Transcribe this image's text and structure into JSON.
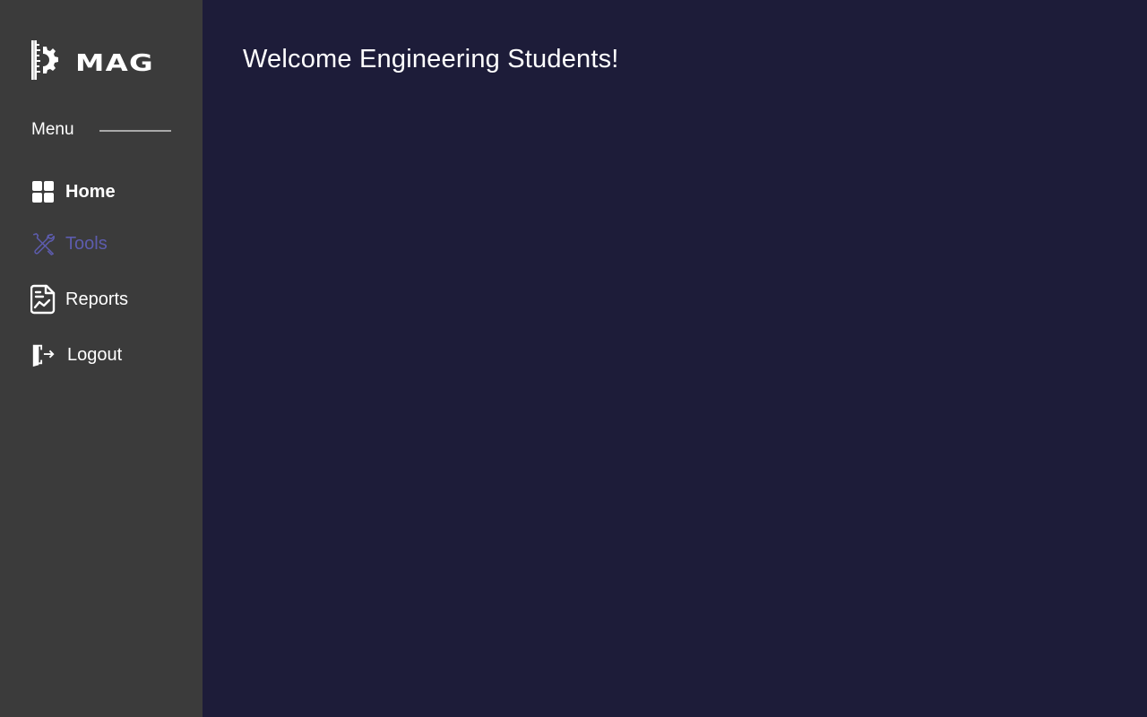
{
  "brand": {
    "name": "MAG",
    "logo_icon": "ruler-gear-icon"
  },
  "sidebar": {
    "menu_heading": "Menu",
    "items": [
      {
        "label": "Home",
        "icon": "grid-icon",
        "active": false
      },
      {
        "label": "Tools",
        "icon": "tools-icon",
        "active": true
      },
      {
        "label": "Reports",
        "icon": "report-icon",
        "active": false
      },
      {
        "label": "Logout",
        "icon": "logout-door-icon",
        "active": false
      }
    ]
  },
  "main": {
    "title": "Welcome Engineering Students!"
  },
  "colors": {
    "sidebar_bg": "#3b3b3b",
    "main_bg": "#1d1c39",
    "active_accent": "#5d5cae",
    "text": "#ffffff"
  }
}
